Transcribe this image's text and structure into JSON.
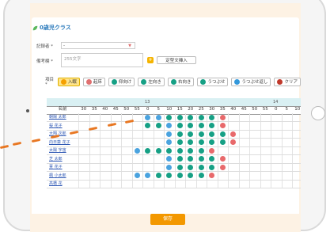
{
  "page": {
    "title": "0歳児クラス"
  },
  "form": {
    "recorder_label": "記録者 *",
    "recorder_value": "-",
    "note_label": "備考欄 *",
    "note_placeholder": "255文字",
    "template_button": "定型文挿入"
  },
  "toolbar": {
    "item_label": "項目 *",
    "buttons": [
      {
        "label": "入眠",
        "icon": "sleep-icon",
        "color": "#f5a000"
      },
      {
        "label": "起床",
        "icon": "wake-icon",
        "color": "#e07070"
      },
      {
        "label": "仰向け",
        "icon": "faceup-icon",
        "color": "#16a085"
      },
      {
        "label": "左向き",
        "icon": "left-icon",
        "color": "#16a085"
      },
      {
        "label": "右向き",
        "icon": "right-icon",
        "color": "#16a085"
      },
      {
        "label": "うつぶせ",
        "icon": "prone-icon",
        "color": "#16a085"
      },
      {
        "label": "うつぶせ返し",
        "icon": "turnback-icon",
        "color": "#3498db"
      },
      {
        "label": "クリア",
        "icon": "clear-icon",
        "color": "#c0392b"
      }
    ]
  },
  "grid": {
    "hour_labels": [
      "13時",
      "14時"
    ],
    "name_header": "名前",
    "minute_headers": [
      "30",
      "35",
      "40",
      "45",
      "50",
      "55",
      "0",
      "5",
      "10",
      "15",
      "20",
      "25",
      "30",
      "35",
      "40",
      "45",
      "50",
      "55",
      "0",
      "5",
      "10",
      "15"
    ],
    "children": [
      {
        "name": "朝陽 太郎"
      },
      {
        "name": "桜 花子"
      },
      {
        "name": "大翔 次郎"
      },
      {
        "name": "向日葵 花子"
      },
      {
        "name": "太陽 宇宙"
      },
      {
        "name": "芝 太郎"
      },
      {
        "name": "菫 花子"
      },
      {
        "name": "楓 小太郎"
      },
      {
        "name": "高橋 花"
      }
    ]
  },
  "colors": {
    "sleep": "#4aa3df",
    "check": "#16a085",
    "wake": "#e8696b",
    "title": "#2f7dbd",
    "save": "#f39800"
  },
  "footer": {
    "save_label": "保存"
  }
}
